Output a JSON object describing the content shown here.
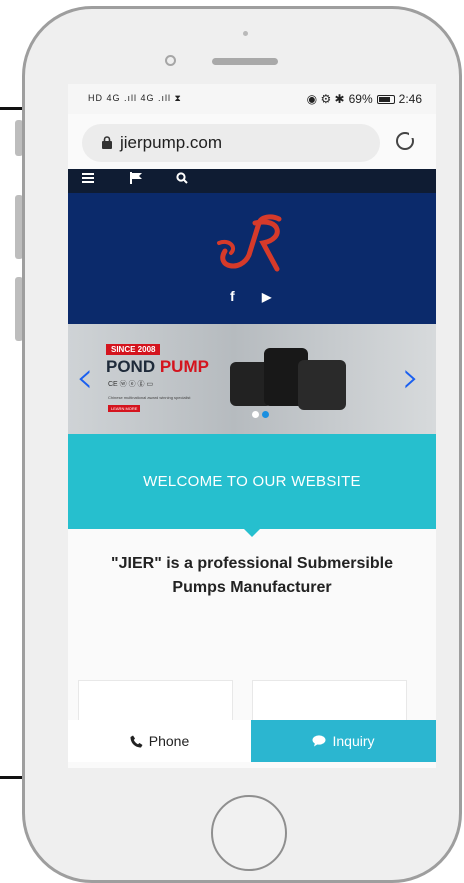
{
  "status_bar": {
    "left_indicators": "HD 4G .ıll 4G .ıll ⧗",
    "right_icons_text": "◉ ⚙ ✱",
    "battery_percent": "69%",
    "time": "2:46"
  },
  "browser": {
    "url": "jierpump.com"
  },
  "nav": {
    "icons": [
      "menu-icon",
      "flag-icon",
      "search-icon"
    ]
  },
  "hero": {
    "logo_text": "JR",
    "social": [
      "f",
      "▶"
    ]
  },
  "banner": {
    "badge": "SINCE 2008",
    "title_a": "POND ",
    "title_b": "PUMP",
    "cert_text": "CE  ⓦ  ⓔ  ⓖ  ▭",
    "sub_text": "Chinese multinational award winning specialist",
    "btn_text": "LEARN MORE"
  },
  "welcome": {
    "title": "WELCOME TO OUR WEBSITE"
  },
  "intro": {
    "text": "\"JIER\" is a professional Submersible Pumps Manufacturer"
  },
  "bottom_bar": {
    "phone_label": "Phone",
    "inquiry_label": "Inquiry"
  },
  "colors": {
    "nav_bg": "#0f1c33",
    "hero_bg": "#0b2a6b",
    "welcome_bg": "#26bfce",
    "inquiry_bg": "#2bb6d0",
    "logo_red": "#d63a2a",
    "arrow_blue": "#1a5ff0"
  }
}
